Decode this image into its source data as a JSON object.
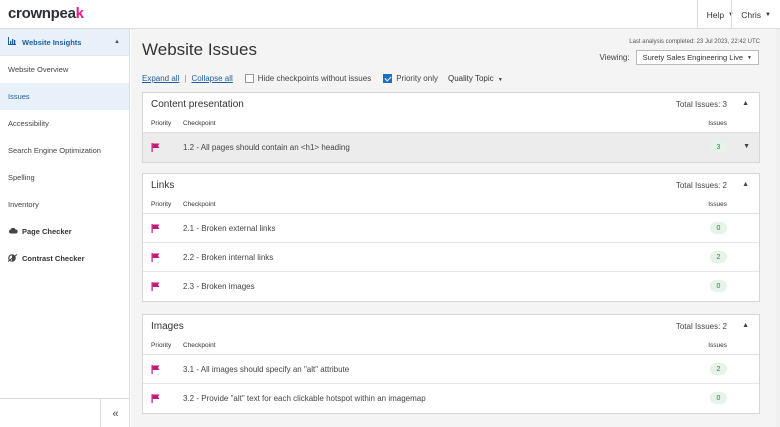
{
  "topbar": {
    "logo_text": "crownpeak",
    "help_label": "Help",
    "user_label": "Chris"
  },
  "sidebar": {
    "section_label": "Website Insights",
    "items": [
      {
        "label": "Website Overview"
      },
      {
        "label": "Issues"
      },
      {
        "label": "Accessibility"
      },
      {
        "label": "Search Engine Optimization"
      },
      {
        "label": "Spelling"
      },
      {
        "label": "Inventory"
      },
      {
        "label": "Page Checker"
      },
      {
        "label": "Contrast Checker"
      }
    ],
    "collapse_glyph": "«"
  },
  "main": {
    "title": "Website Issues",
    "last_analysis": "Last analysis completed: 23 Jul 2023, 22:42 UTC",
    "viewing_label": "Viewing:",
    "viewing_value": "Surety Sales Engineering Live",
    "toolbar": {
      "expand_all": "Expand all",
      "separator": "|",
      "collapse_all": "Collapse all",
      "hide_checkpoints": "Hide checkpoints without issues",
      "priority_only": "Priority only",
      "quality_topic": "Quality Topic"
    },
    "columns": {
      "priority": "Priority",
      "checkpoint": "Checkpoint",
      "issues": "Issues"
    },
    "panels": [
      {
        "title": "Content presentation",
        "total": "Total Issues: 3",
        "rows": [
          {
            "checkpoint": "1.2 - All pages should contain an <h1> heading",
            "issues": "3"
          }
        ]
      },
      {
        "title": "Links",
        "total": "Total Issues: 2",
        "rows": [
          {
            "checkpoint": "2.1 - Broken external links",
            "issues": "0"
          },
          {
            "checkpoint": "2.2 - Broken internal links",
            "issues": "2"
          },
          {
            "checkpoint": "2.3 - Broken images",
            "issues": "0"
          }
        ]
      },
      {
        "title": "Images",
        "total": "Total Issues: 2",
        "rows": [
          {
            "checkpoint": "3.1 - All images should specify an \"alt\" attribute",
            "issues": "2"
          },
          {
            "checkpoint": "3.2 - Provide \"alt\" text for each clickable hotspot within an imagemap",
            "issues": "0"
          }
        ]
      }
    ]
  },
  "colors": {
    "brand_accent": "#e0218a",
    "link_blue": "#1d5fa0",
    "badge_green": "#2f7d3c",
    "flag_magenta": "#c2187a"
  }
}
